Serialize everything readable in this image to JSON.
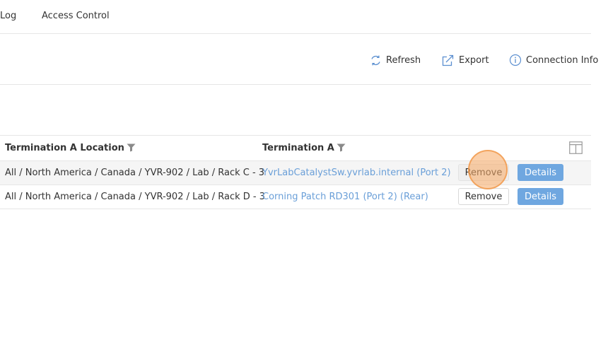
{
  "tabs": [
    {
      "label": "Log"
    },
    {
      "label": "Access Control"
    }
  ],
  "toolbar": {
    "refresh_label": "Refresh",
    "export_label": "Export",
    "connection_info_label": "Connection Info"
  },
  "table": {
    "columns": [
      {
        "label": "Termination A Location",
        "filter_icon": "filter-icon"
      },
      {
        "label": "Termination A",
        "filter_icon": "filter-icon"
      }
    ],
    "rows": [
      {
        "location": "All / North America / Canada / YVR-902 / Lab / Rack C - 3",
        "termination": "YvrLabCatalystSw.yvrlab.internal (Port 2)",
        "remove_label": "Remove",
        "details_label": "Details"
      },
      {
        "location": "All / North America / Canada / YVR-902 / Lab / Rack D - 3",
        "termination": "Corning Patch RD301 (Port 2) (Rear)",
        "remove_label": "Remove",
        "details_label": "Details"
      }
    ]
  },
  "colors": {
    "accent": "#6fa7e0",
    "link": "#6a9fd8",
    "icon": "#5b8fd0",
    "border": "#e6e6e6"
  }
}
